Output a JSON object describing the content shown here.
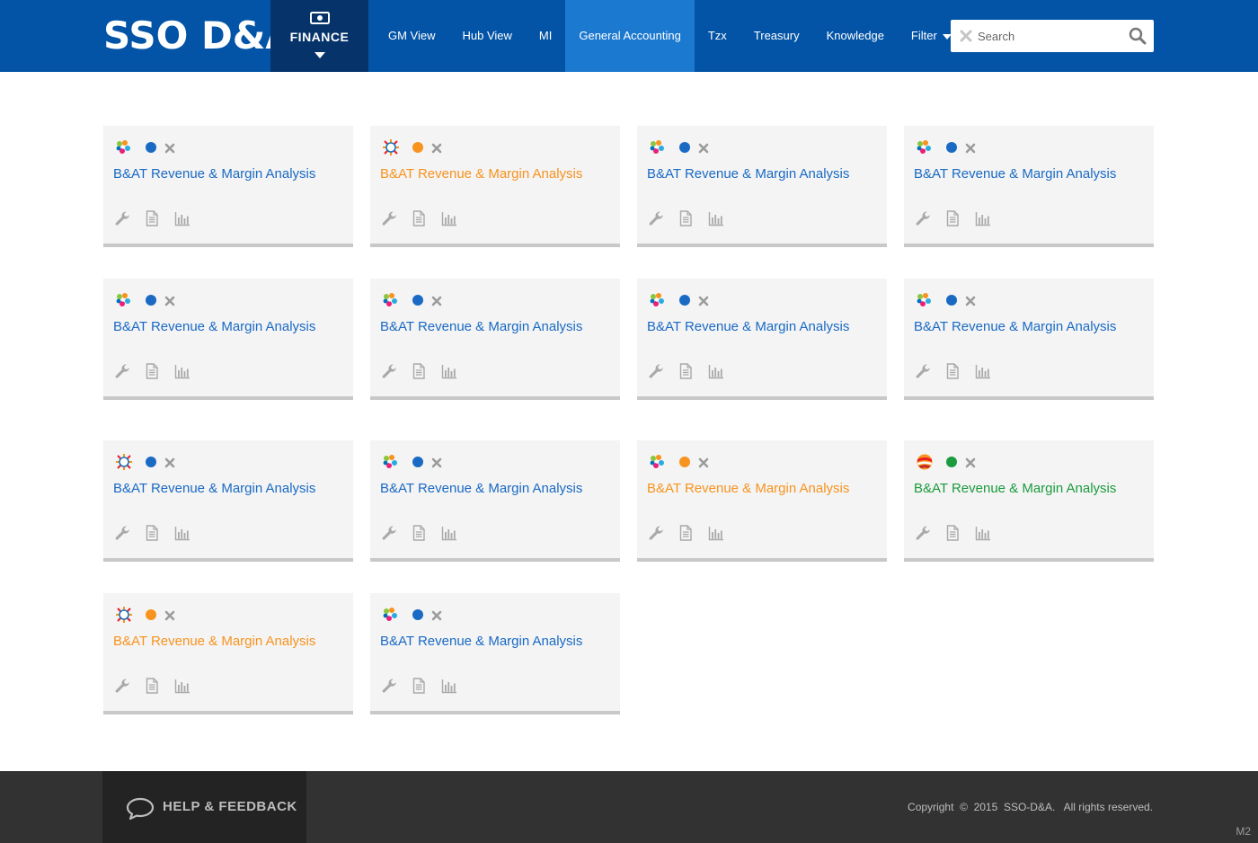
{
  "header": {
    "logo": "SSO D&A",
    "finance_label": "FINANCE",
    "nav": [
      {
        "label": "GM View"
      },
      {
        "label": "Hub View"
      },
      {
        "label": "MI"
      },
      {
        "label": "General Accounting"
      },
      {
        "label": "Tzx"
      },
      {
        "label": "Treasury"
      },
      {
        "label": "Knowledge"
      },
      {
        "label": "Filter"
      }
    ],
    "active_nav": "General Accounting",
    "search_placeholder": "Search"
  },
  "colors": {
    "header_bg": "#0354a7",
    "finance_bg": "#05336a",
    "active_nav_bg": "#1c79d0",
    "blue": "#1a6ac4",
    "orange": "#f7931e",
    "green": "#1a9b3e",
    "footer_bg": "#323232"
  },
  "cards": [
    {
      "title": "B&AT Revenue & Margin Analysis",
      "status": "blue",
      "brand_icon": "pinwheel-icon"
    },
    {
      "title": "B&AT Revenue & Margin Analysis",
      "status": "orange",
      "brand_icon": "sun-icon"
    },
    {
      "title": "B&AT Revenue & Margin Analysis",
      "status": "blue",
      "brand_icon": "pinwheel-icon"
    },
    {
      "title": "B&AT Revenue & Margin Analysis",
      "status": "blue",
      "brand_icon": "pinwheel-icon"
    },
    {
      "title": "B&AT Revenue & Margin Analysis",
      "status": "blue",
      "brand_icon": "pinwheel-icon"
    },
    {
      "title": "B&AT Revenue & Margin Analysis",
      "status": "blue",
      "brand_icon": "pinwheel-icon"
    },
    {
      "title": "B&AT Revenue & Margin Analysis",
      "status": "blue",
      "brand_icon": "pinwheel-icon"
    },
    {
      "title": "B&AT Revenue & Margin Analysis",
      "status": "blue",
      "brand_icon": "pinwheel-icon"
    },
    {
      "title": "B&AT Revenue & Margin Analysis",
      "status": "blue",
      "brand_icon": "sun-icon"
    },
    {
      "title": "B&AT Revenue & Margin Analysis",
      "status": "blue",
      "brand_icon": "pinwheel-icon"
    },
    {
      "title": "B&AT Revenue & Margin Analysis",
      "status": "orange",
      "brand_icon": "pinwheel-icon"
    },
    {
      "title": "B&AT Revenue & Margin Analysis",
      "status": "green",
      "brand_icon": "ball-icon"
    },
    {
      "title": "B&AT Revenue & Margin Analysis",
      "status": "orange",
      "brand_icon": "sun-icon"
    },
    {
      "title": "B&AT Revenue & Margin Analysis",
      "status": "blue",
      "brand_icon": "pinwheel-icon"
    }
  ],
  "footer": {
    "help_label": "HELP & FEEDBACK",
    "copyright": "Copyright  ©  2015  SSO-D&A.   All rights reserved.",
    "version": "M2"
  }
}
